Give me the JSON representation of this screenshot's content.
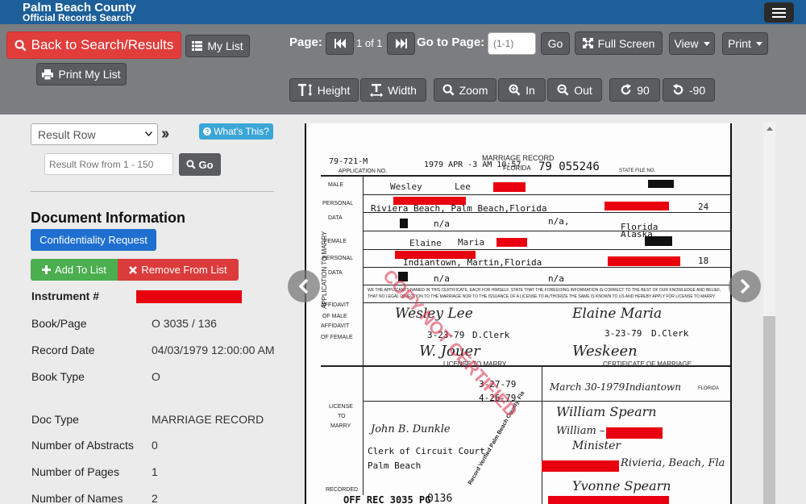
{
  "header": {
    "county": "Palm Beach County",
    "subtitle": "Official Records Search"
  },
  "toolbar": {
    "back_label": "Back to Search/Results",
    "my_list_label": "My List",
    "print_list_label": "Print My List",
    "page_label": "Page:",
    "page_info": "1 of 1",
    "goto_label": "Go to Page:",
    "goto_placeholder": "(1-1)",
    "go_label": "Go",
    "fullscreen_label": "Full Screen",
    "view_label": "View",
    "print_label": "Print",
    "height_label": "Height",
    "width_label": "Width",
    "zoom_label": "Zoom",
    "in_label": "In",
    "out_label": "Out",
    "rotate_cw_label": "90",
    "rotate_ccw_label": "-90"
  },
  "left": {
    "result_row_select": "Result Row",
    "whats_this": "What's This?",
    "row_input_placeholder": "Result Row from 1 - 150",
    "go_label": "Go",
    "doc_info_heading": "Document Information",
    "confidentiality_label": "Confidentiality Request",
    "add_label": "Add To List",
    "remove_label": "Remove From List",
    "fields": [
      {
        "label": "Instrument #",
        "value": ""
      },
      {
        "label": "Book/Page",
        "value": "O 3035 / 136"
      },
      {
        "label": "Record Date",
        "value": "04/03/1979 12:00:00 AM"
      },
      {
        "label": "Book Type",
        "value": "O"
      },
      {
        "label": "Doc Type",
        "value": "MARRIAGE RECORD"
      },
      {
        "label": "Number of Abstracts",
        "value": "0"
      },
      {
        "label": "Number of Pages",
        "value": "1"
      },
      {
        "label": "Number of Names",
        "value": "2"
      }
    ]
  },
  "document": {
    "title": "MARRIAGE RECORD",
    "state": "FLORIDA",
    "app_no": "79-721-M",
    "app_label": "APPLICATION NO.",
    "date_stamp": "1979 APR -3  AM 10:57",
    "state_no": "79  055246",
    "state_file_label": "STATE FILE NO.",
    "side_labels": [
      "MALE",
      "PERSONAL",
      "DATA",
      "FEMALE",
      "PERSONAL",
      "DATA",
      "AFFIDAVIT",
      "OF MALE",
      "AFFIDAVIT",
      "OF FEMALE",
      "LICENSE",
      "TO",
      "MARRY",
      "RECORDED"
    ],
    "vertical_label": "APPLICATION TO MARRY",
    "male_first": "Wesley",
    "male_middle": "Lee",
    "male_residence": "Riviera Beach, Palm Beach,Florida",
    "male_birthplace": "Florida",
    "male_age": "24",
    "male_last_marriage": "n/a",
    "male_last_marriage_2": "n/a,",
    "female_first": "Elaine",
    "female_middle": "Maria",
    "female_residence": "Indiantown, Martin,Florida",
    "female_birthplace": "Alaska",
    "female_age": "18",
    "female_last_marriage": "n/a",
    "female_last_marriage_2": "n/a",
    "license_heading": "LICENSE TO MARRY",
    "certificate_heading": "CERTIFICATE OF MARRIAGE",
    "date_issued": "3-27-79",
    "expiration_date": "4-26-79",
    "affidavit_date_1": "3-23-79",
    "affidavit_date_2": "3-23-79",
    "affidavit_title": "D.Clerk",
    "marriage_date": "March 30-1979",
    "marriage_city": "Indiantown",
    "marriage_state": "FLORIDA",
    "officiant_title": "Minister",
    "clerk": "Clerk of Circuit Court",
    "county": "Palm Beach",
    "officiant_address": "Rivieria, Beach, Fla",
    "recorded": "OFF REC 3035 PG",
    "recorded_page": "0136",
    "stamp_text": "COPY NOT CERTIFIED",
    "verified_text": "Record Verified Palm Beach County, Fla"
  },
  "colors": {
    "header_bg": "#1d5f99",
    "toolbar_bg": "#7b7d80",
    "back_button": "#e13d3b",
    "confidentiality_button": "#1f6fd0",
    "add_button": "#4bae4f",
    "remove_button": "#db3b3b",
    "redaction": "#e8000f"
  },
  "icons": [
    "hamburger-icon",
    "search-icon",
    "list-icon",
    "print-icon",
    "first-page-icon",
    "last-page-icon",
    "fullscreen-icon",
    "caret-down-icon",
    "text-height-icon",
    "text-width-icon",
    "zoom-icon",
    "zoom-in-icon",
    "zoom-out-icon",
    "rotate-cw-icon",
    "rotate-ccw-icon",
    "question-icon",
    "plus-icon",
    "times-icon",
    "chevron-left-icon",
    "chevron-right-icon"
  ]
}
